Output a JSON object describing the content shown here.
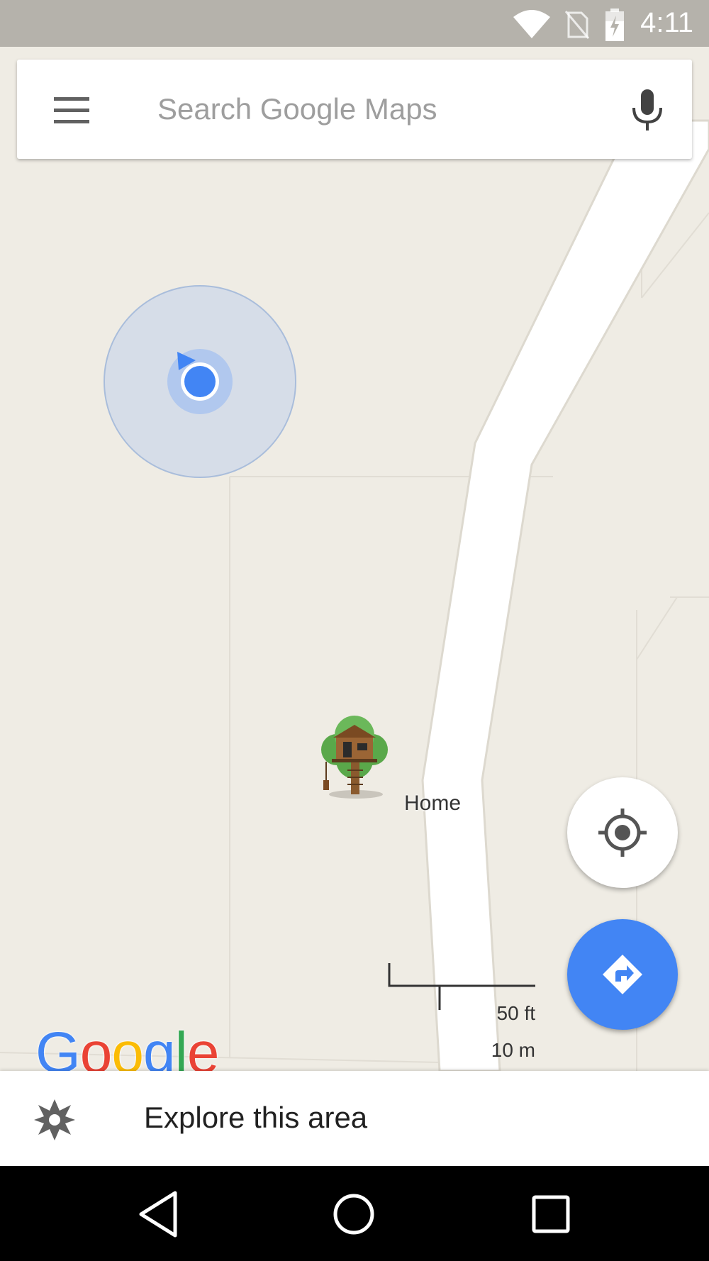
{
  "status_bar": {
    "time": "4:11",
    "icons": [
      "wifi-icon",
      "no-sim-icon",
      "battery-charging-icon"
    ]
  },
  "search": {
    "placeholder": "Search Google Maps",
    "menu_icon": "hamburger-menu-icon",
    "mic_icon": "microphone-icon"
  },
  "map": {
    "place_label": "Home",
    "place_icon": "treehouse-icon",
    "scale": {
      "imperial": "50 ft",
      "metric": "10 m"
    },
    "logo": "Google",
    "colors": {
      "land": "#efece4",
      "road": "#ffffff",
      "location_blue": "#4285f4"
    }
  },
  "buttons": {
    "my_location_icon": "my-location-icon",
    "directions_icon": "directions-icon"
  },
  "explore": {
    "label": "Explore this area",
    "icon": "explore-compass-icon"
  },
  "nav_bar": {
    "icons": [
      "back-icon",
      "home-icon",
      "recents-icon"
    ]
  }
}
